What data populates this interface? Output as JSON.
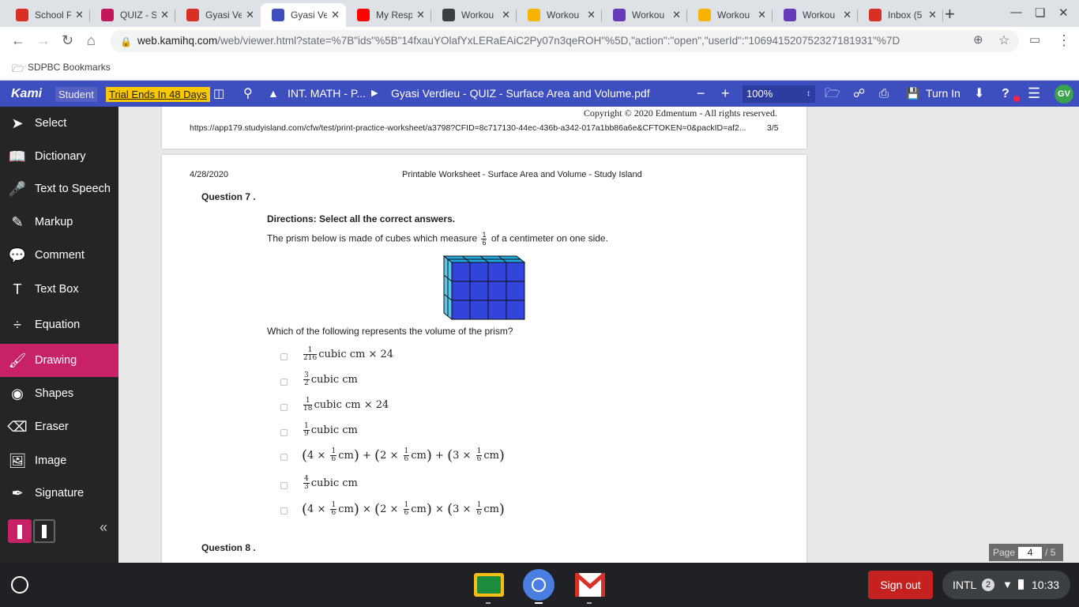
{
  "browser": {
    "tabs": [
      {
        "title": "School P",
        "favicon": "circle-red-icon",
        "color": "#d93025"
      },
      {
        "title": "QUIZ - S",
        "favicon": "person-pink-icon",
        "color": "#c2185b"
      },
      {
        "title": "Gyasi Ve",
        "favicon": "pdf-icon",
        "color": "#d93025"
      },
      {
        "title": "Gyasi Ve",
        "favicon": "kami-icon",
        "color": "#3d4ebf"
      },
      {
        "title": "My Resp",
        "favicon": "youtube-icon",
        "color": "#ff0000"
      },
      {
        "title": "Workou",
        "favicon": "classroom-icon",
        "color": "#3c4043"
      },
      {
        "title": "Workou",
        "favicon": "slides-icon",
        "color": "#f4b400"
      },
      {
        "title": "Workou",
        "favicon": "forms-icon",
        "color": "#673ab7"
      },
      {
        "title": "Workou",
        "favicon": "slides-icon",
        "color": "#f4b400"
      },
      {
        "title": "Workou",
        "favicon": "forms-icon",
        "color": "#673ab7"
      },
      {
        "title": "Inbox (5",
        "favicon": "gmail-icon",
        "color": "#d93025"
      }
    ],
    "active_tab": 3,
    "url_host": "web.kamihq.com",
    "url_path": "/web/viewer.html?state=%7B\"ids\"%5B\"14fxauYOlafYxLERaEAiC2Py07n3qeROH\"%5D,\"action\":\"open\",\"userId\":\"106941520752327181931\"%7D",
    "bookmarks_label": "SDPBC Bookmarks"
  },
  "kami": {
    "logo": "Kami",
    "student_badge": "Student",
    "trial_badge": "Trial Ends In 48 Days",
    "breadcrumb_folder": "INT. MATH - P...",
    "file_name": "Gyasi Verdieu - QUIZ - Surface Area and Volume.pdf",
    "zoom": "100%",
    "turn_in": "Turn In",
    "avatar": "GV",
    "accent": "#3d4ebf"
  },
  "sidebar": {
    "items": [
      {
        "label": "Select",
        "icon": "cursor-arrow-icon"
      },
      {
        "label": "Dictionary",
        "icon": "book-icon"
      },
      {
        "label": "Text to Speech",
        "icon": "speech-icon"
      },
      {
        "label": "Markup",
        "icon": "highlighter-icon"
      },
      {
        "label": "Comment",
        "icon": "comment-icon"
      },
      {
        "label": "Text Box",
        "icon": "text-t-icon"
      },
      {
        "label": "Equation",
        "icon": "divide-icon"
      },
      {
        "label": "Drawing",
        "icon": "brush-icon"
      },
      {
        "label": "Shapes",
        "icon": "shapes-icon"
      },
      {
        "label": "Eraser",
        "icon": "eraser-icon"
      },
      {
        "label": "Image",
        "icon": "image-icon"
      },
      {
        "label": "Signature",
        "icon": "pen-nib-icon"
      }
    ],
    "active_item": "Drawing",
    "active_color": "#c72168"
  },
  "drawing_panel": {
    "size": "1",
    "colors": [
      "#000000",
      "#00ee22",
      "#ff0099"
    ]
  },
  "page3_footer": {
    "copyright": "Copyright © 2020 Edmentum - All rights reserved.",
    "url": "https://app179.studyisland.com/cfw/test/print-practice-worksheet/a3798?CFID=8c717130-44ec-436b-a342-017a1bb86a6e&CFTOKEN=0&packID=af2...",
    "page_num": "3/5"
  },
  "page4": {
    "date": "4/28/2020",
    "header_title": "Printable Worksheet - Surface Area and Volume - Study Island",
    "question_label": "Question 7 .",
    "directions": "Directions: Select all the correct answers.",
    "prompt_before": "The prism below is made of cubes which measure",
    "prompt_fraction": {
      "num": "1",
      "den": "6"
    },
    "prompt_after": "of a centimeter on one side.",
    "question_text": "Which of the following represents the volume of the prism?",
    "options": [
      {
        "fraction": {
          "num": "1",
          "den": "216"
        },
        "text": "cubic cm × 24"
      },
      {
        "fraction": {
          "num": "3",
          "den": "2"
        },
        "text": "cubic cm"
      },
      {
        "fraction": {
          "num": "1",
          "den": "18"
        },
        "text": "cubic cm × 24"
      },
      {
        "fraction": {
          "num": "1",
          "den": "9"
        },
        "text": "cubic cm"
      },
      {
        "expr": {
          "a": "4",
          "b": "2",
          "c": "3",
          "op": "+",
          "unit": "cm",
          "num": "1",
          "den": "6"
        }
      },
      {
        "fraction": {
          "num": "4",
          "den": "3"
        },
        "text": "cubic cm"
      },
      {
        "expr": {
          "a": "4",
          "b": "2",
          "c": "3",
          "op": "×",
          "unit": "cm",
          "num": "1",
          "den": "6"
        }
      }
    ],
    "next_question_label": "Question 8 ."
  },
  "pager": {
    "label": "Page",
    "current": "4",
    "total": "/ 5"
  },
  "shelf": {
    "sign_out": "Sign out",
    "ime": "INTL",
    "notification_count": "2",
    "time": "10:33"
  }
}
